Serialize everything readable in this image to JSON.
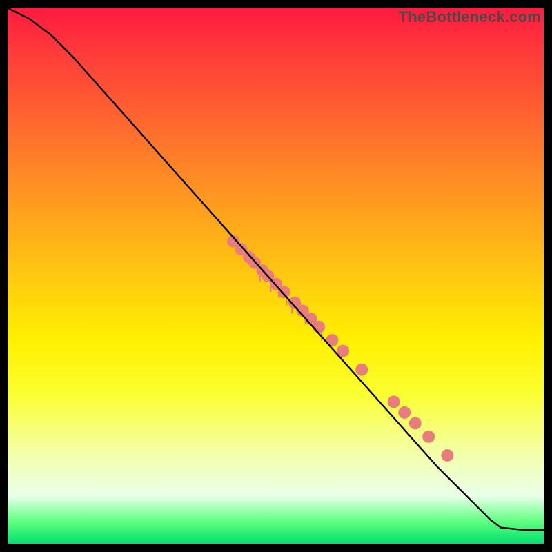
{
  "watermark": "TheBottleneck.com",
  "chart_data": {
    "type": "line",
    "title": "",
    "xlabel": "",
    "ylabel": "",
    "xlim": [
      0,
      100
    ],
    "ylim": [
      0,
      100
    ],
    "grid": false,
    "series": [
      {
        "name": "curve",
        "type": "line",
        "color": "#000000",
        "x": [
          0,
          4,
          8,
          12,
          16,
          20,
          24,
          28,
          32,
          36,
          40,
          44,
          48,
          52,
          56,
          60,
          64,
          68,
          72,
          76,
          80,
          84,
          88,
          90,
          92,
          96,
          100
        ],
        "y": [
          100,
          98,
          95,
          91,
          86.5,
          82,
          77.5,
          73,
          68.5,
          64,
          59.5,
          55,
          50.5,
          46,
          41.5,
          37,
          32.5,
          28,
          23.5,
          19,
          14.5,
          10.5,
          6.5,
          4.5,
          3.0,
          2.6,
          2.6
        ]
      },
      {
        "name": "dots",
        "type": "scatter",
        "color": "#e97c7c",
        "radius": 9,
        "points": [
          {
            "x": 42.0,
            "y": 56.5
          },
          {
            "x": 43.5,
            "y": 55.0
          },
          {
            "x": 45.0,
            "y": 53.5
          },
          {
            "x": 46.0,
            "y": 52.5
          },
          {
            "x": 47.5,
            "y": 51.0
          },
          {
            "x": 48.5,
            "y": 50.0
          },
          {
            "x": 50.0,
            "y": 48.5
          },
          {
            "x": 51.5,
            "y": 47.0
          },
          {
            "x": 53.5,
            "y": 45.0
          },
          {
            "x": 55.0,
            "y": 43.5
          },
          {
            "x": 56.5,
            "y": 42.0
          },
          {
            "x": 58.0,
            "y": 40.5
          },
          {
            "x": 60.5,
            "y": 38.0
          },
          {
            "x": 62.5,
            "y": 36.0
          },
          {
            "x": 66.0,
            "y": 32.5
          },
          {
            "x": 72.0,
            "y": 26.5
          },
          {
            "x": 74.0,
            "y": 24.5
          },
          {
            "x": 76.0,
            "y": 22.5
          },
          {
            "x": 78.5,
            "y": 20.0
          },
          {
            "x": 82.0,
            "y": 16.5
          }
        ]
      },
      {
        "name": "spikes",
        "type": "bar",
        "color": "#e97c7c",
        "width": 0.25,
        "points": [
          {
            "x": 47.0,
            "baseline": 51.5,
            "y": 49.0
          },
          {
            "x": 49.0,
            "baseline": 49.5,
            "y": 47.0
          },
          {
            "x": 50.5,
            "baseline": 48.0,
            "y": 46.0
          },
          {
            "x": 52.0,
            "baseline": 46.5,
            "y": 44.5
          },
          {
            "x": 53.0,
            "baseline": 45.5,
            "y": 43.0
          },
          {
            "x": 55.5,
            "baseline": 43.0,
            "y": 41.0
          },
          {
            "x": 58.5,
            "baseline": 40.0,
            "y": 38.0
          }
        ]
      }
    ]
  }
}
